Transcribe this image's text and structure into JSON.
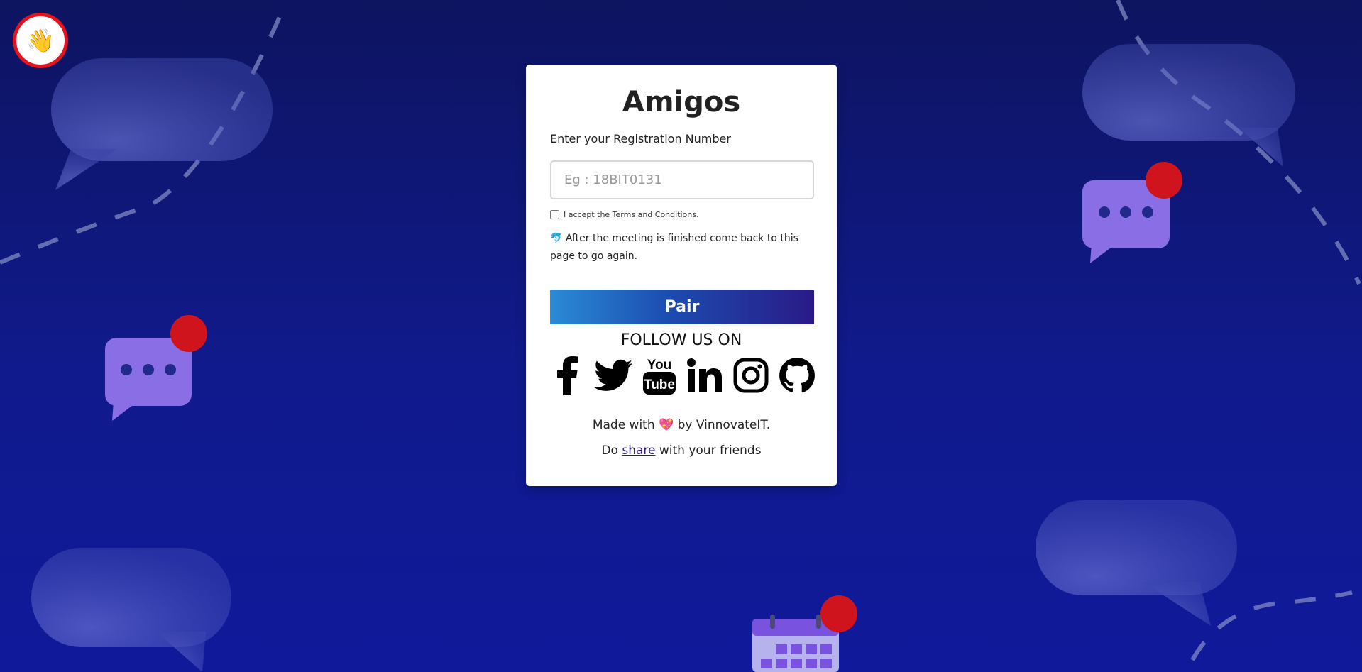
{
  "app": {
    "title": "Amigos",
    "wave_emoji": "👋"
  },
  "form": {
    "label": "Enter your Registration Number",
    "placeholder": "Eg : 18BIT0131",
    "value": "",
    "terms_label": "I accept the Terms and Conditions.",
    "terms_checked": false,
    "note": "After the meeting is finished come back to this page to go again.",
    "note_emoji": "🐬",
    "pair_label": "Pair"
  },
  "follow": {
    "heading": "FOLLOW US ON",
    "networks": [
      "facebook-icon",
      "twitter-icon",
      "youtube-icon",
      "linkedin-icon",
      "instagram-icon",
      "github-icon"
    ]
  },
  "footer": {
    "made_prefix": "Made with",
    "heart": "💖",
    "made_suffix": "by VinnovateIT.",
    "share_prefix": "Do",
    "share_link": "share",
    "share_suffix": "with your friends"
  },
  "colors": {
    "background": "#0d1460",
    "accent_red": "#e3141c",
    "bubble_purple": "#8a6ee6",
    "button_gradient_start": "#2a8bd6",
    "button_gradient_end": "#2a1a86"
  }
}
